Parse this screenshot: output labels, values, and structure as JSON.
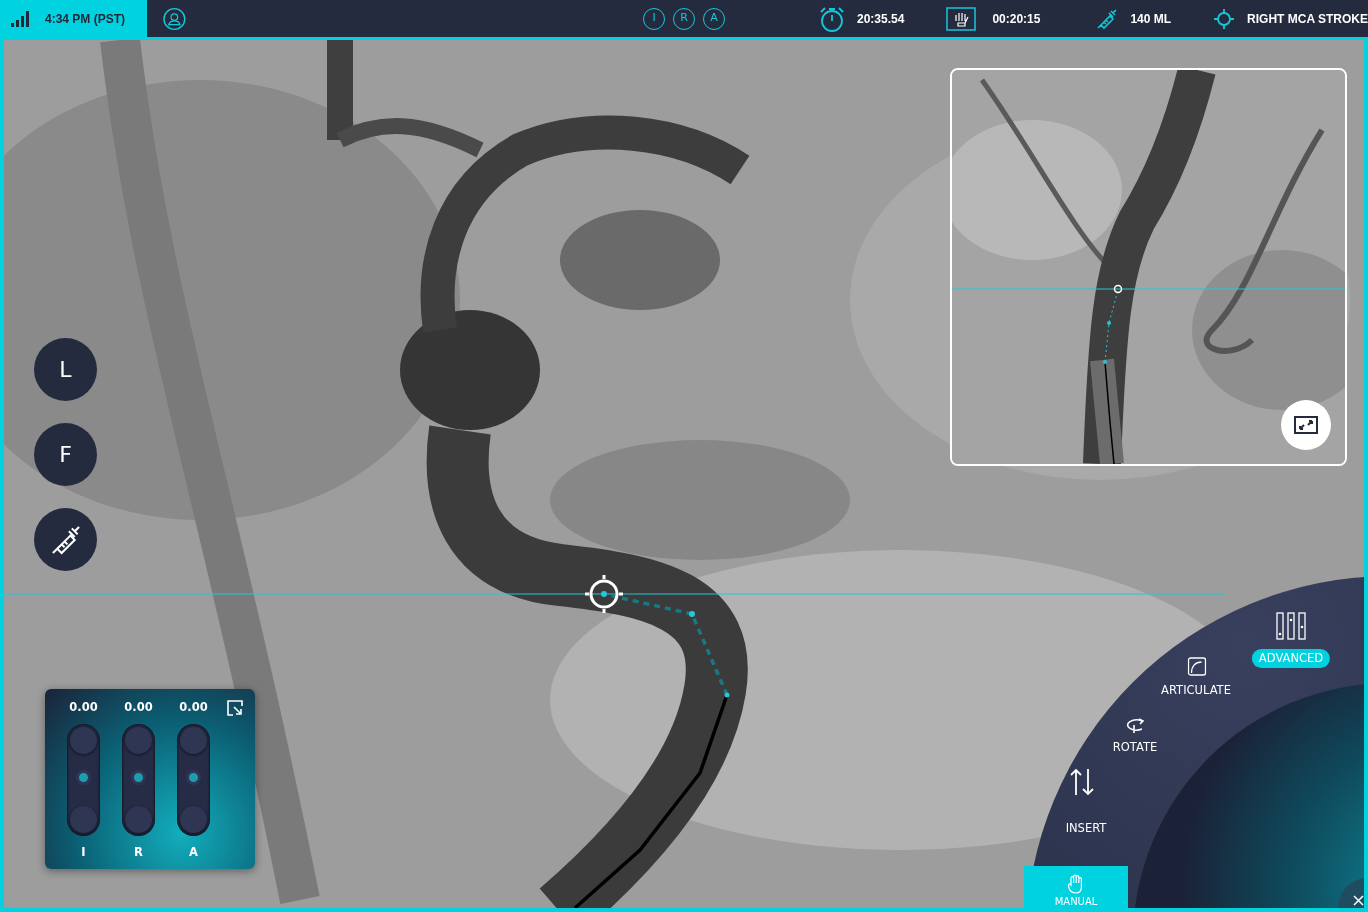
{
  "status_bar": {
    "time": "4:34 PM (PST)"
  },
  "view_buttons": [
    {
      "label": "I"
    },
    {
      "label": "R"
    },
    {
      "label": "A"
    }
  ],
  "stats": [
    {
      "kind": "timer",
      "value": "20:35.54"
    },
    {
      "kind": "fluoro",
      "value": "00:20:15"
    },
    {
      "kind": "contrast",
      "value": "140 ML"
    },
    {
      "kind": "target",
      "value": "RIGHT MCA STROKE"
    }
  ],
  "side_buttons": [
    {
      "kind": "text",
      "label": "L"
    },
    {
      "kind": "text",
      "label": "F"
    },
    {
      "kind": "syringe"
    }
  ],
  "joystick_panel": {
    "axes": [
      {
        "reading": "0.00",
        "label": "I",
        "level": 0.5
      },
      {
        "reading": "0.00",
        "label": "R",
        "level": 0.5
      },
      {
        "reading": "0.00",
        "label": "A",
        "level": 0.5
      }
    ]
  },
  "mode_menu": {
    "items": [
      {
        "kind": "insert",
        "label": "INSERT",
        "selected": false
      },
      {
        "kind": "rotate",
        "label": "ROTATE",
        "selected": false
      },
      {
        "kind": "articulate",
        "label": "ARTICULATE",
        "selected": false
      },
      {
        "kind": "advanced",
        "label": "ADVANCED",
        "selected": true
      }
    ],
    "manual": {
      "label": "MANUAL",
      "selected": true
    }
  }
}
